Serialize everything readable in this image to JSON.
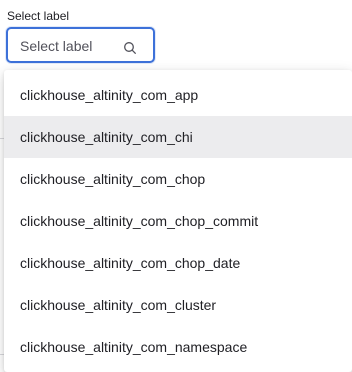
{
  "field": {
    "label": "Select label",
    "placeholder": "Select label",
    "icon": "search-icon"
  },
  "dropdown": {
    "highlighted_index": 1,
    "options": [
      "clickhouse_altinity_com_app",
      "clickhouse_altinity_com_chi",
      "clickhouse_altinity_com_chop",
      "clickhouse_altinity_com_chop_commit",
      "clickhouse_altinity_com_chop_date",
      "clickhouse_altinity_com_cluster",
      "clickhouse_altinity_com_namespace"
    ]
  },
  "colors": {
    "focus_border": "#3d71d9",
    "highlight_bg": "#ececee",
    "text": "#1f1f24"
  }
}
